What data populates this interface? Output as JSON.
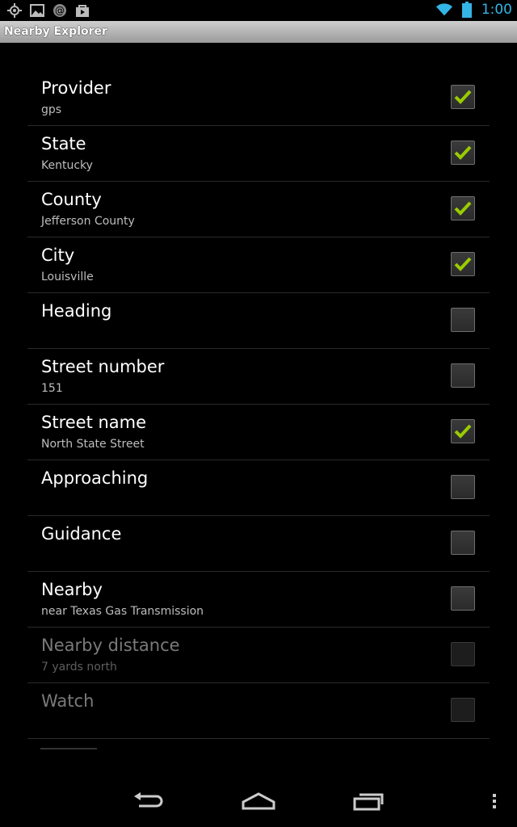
{
  "status_bar": {
    "time": "1:00",
    "left_icons": [
      "gps-icon",
      "gallery-icon",
      "email-at-icon",
      "store-bag-icon"
    ],
    "right_icons": [
      "wifi-icon",
      "battery-icon"
    ]
  },
  "app": {
    "title": "Nearby Explorer"
  },
  "colors": {
    "accent": "#33b5e5",
    "check": "#99cc00"
  },
  "preferences": [
    {
      "title": "Provider",
      "summary": "gps",
      "checked": true,
      "enabled": true
    },
    {
      "title": "State",
      "summary": "Kentucky",
      "checked": true,
      "enabled": true
    },
    {
      "title": "County",
      "summary": "Jefferson County",
      "checked": true,
      "enabled": true
    },
    {
      "title": "City",
      "summary": "Louisville",
      "checked": true,
      "enabled": true
    },
    {
      "title": "Heading",
      "summary": "",
      "checked": false,
      "enabled": true
    },
    {
      "title": "Street number",
      "summary": "151",
      "checked": false,
      "enabled": true
    },
    {
      "title": "Street name",
      "summary": "North State Street",
      "checked": true,
      "enabled": true
    },
    {
      "title": "Approaching",
      "summary": "",
      "checked": false,
      "enabled": true
    },
    {
      "title": "Guidance",
      "summary": "",
      "checked": false,
      "enabled": true
    },
    {
      "title": "Nearby",
      "summary": "near Texas Gas Transmission",
      "checked": false,
      "enabled": true
    },
    {
      "title": "Nearby distance",
      "summary": "7 yards north",
      "checked": false,
      "enabled": false
    },
    {
      "title": "Watch",
      "summary": "",
      "checked": false,
      "enabled": false
    }
  ],
  "nav_bar": {
    "buttons": [
      "back-icon",
      "home-icon",
      "recents-icon"
    ],
    "menu": "overflow-menu-icon"
  }
}
